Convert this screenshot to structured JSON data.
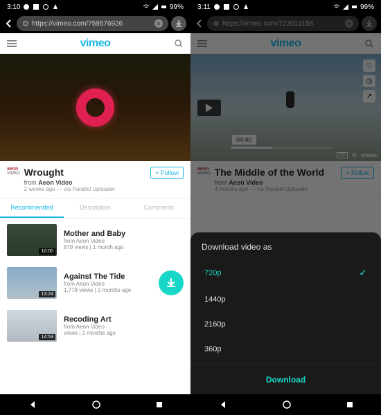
{
  "left": {
    "status": {
      "time": "3:10",
      "battery": "99%"
    },
    "url": "https://vimeo.com/759576926",
    "logo": "vimeo",
    "video": {
      "title": "Wrought",
      "channel_logo_top": "aeon",
      "channel_logo_bot": "VIDEO",
      "from_prefix": "from ",
      "from": "Aeon Video",
      "posted": "2 weeks ago — via Parallel Uploader",
      "follow": "+ Follow"
    },
    "tabs": [
      "Recommended",
      "Description",
      "Comments"
    ],
    "items": [
      {
        "title": "Mother and Baby",
        "from": "from Aeon Video",
        "meta": "879 views | 1 month ago",
        "dur": "10:00"
      },
      {
        "title": "Against The Tide",
        "from": "from Aeon Video",
        "meta": "1,778 views | 2 months ago",
        "dur": "13:24"
      },
      {
        "title": "Recoding Art",
        "from": "from Aeon Video",
        "meta": "views | 2 months ago",
        "dur": "14:53"
      }
    ]
  },
  "right": {
    "status": {
      "time": "3:11",
      "battery": "99%"
    },
    "url": "https://vimeo.com/723013156",
    "logo": "vimeo",
    "video": {
      "title": "The Middle of the World",
      "channel_logo_top": "aeon",
      "channel_logo_bot": "VIDEO",
      "from_prefix": "from ",
      "from": "Aeon Video",
      "posted": "4 months ago — via Parallel Uploader",
      "follow": "+ Follow",
      "duration": "04:40",
      "brand": "vimeo"
    },
    "sheet": {
      "title": "Download video as",
      "options": [
        "720p",
        "1440p",
        "2160p",
        "360p"
      ],
      "selected": 0,
      "action": "Download"
    }
  }
}
